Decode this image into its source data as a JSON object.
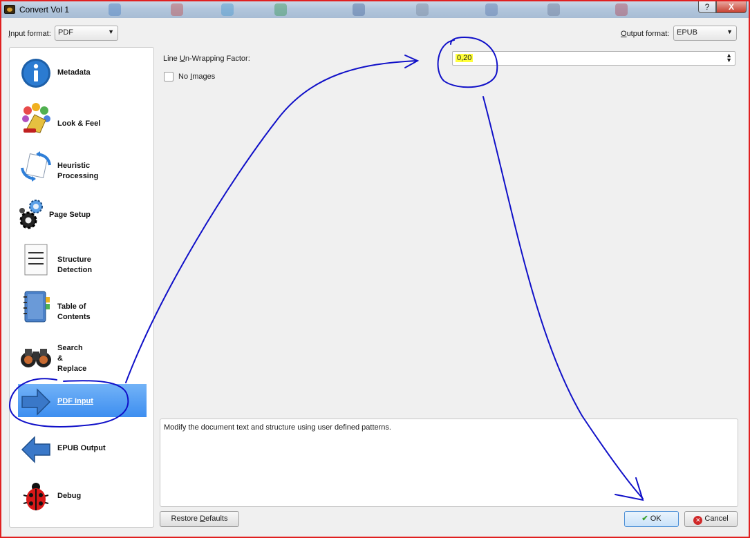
{
  "window": {
    "title": "Convert Vol 1",
    "help_label": "?",
    "close_label": "X"
  },
  "format_bar": {
    "input_label_prefix": "",
    "input_label_u": "I",
    "input_label_rest": "nput format:",
    "input_value": "PDF",
    "output_label_prefix": "",
    "output_label_u": "O",
    "output_label_rest": "utput format:",
    "output_value": "EPUB"
  },
  "sidebar": {
    "items": [
      {
        "label": "Metadata",
        "icon": "info-icon"
      },
      {
        "label": "Look & Feel",
        "icon": "palette-icon"
      },
      {
        "label": "Heuristic\nProcessing",
        "icon": "heuristic-icon"
      },
      {
        "label": "Page Setup",
        "icon": "gears-icon"
      },
      {
        "label": "Structure\nDetection",
        "icon": "document-icon"
      },
      {
        "label": "Table of\nContents",
        "icon": "notebook-icon"
      },
      {
        "label": "Search\n&\nReplace",
        "icon": "binoculars-icon"
      },
      {
        "label": "PDF Input",
        "icon": "arrow-right-icon",
        "active": true
      },
      {
        "label": "EPUB Output",
        "icon": "arrow-left-icon"
      },
      {
        "label": "Debug",
        "icon": "ladybug-icon"
      }
    ]
  },
  "pdf_input": {
    "unwrap_label_prefix": "Line ",
    "unwrap_label_u": "U",
    "unwrap_label_rest": "n-Wrapping Factor:",
    "unwrap_value": "0,20",
    "no_images_prefix": "No ",
    "no_images_u": "I",
    "no_images_rest": "mages",
    "no_images_checked": false
  },
  "help_text": "Modify the document text and structure using user defined patterns.",
  "buttons": {
    "restore_prefix": "Restore ",
    "restore_u": "D",
    "restore_rest": "efaults",
    "ok": "OK",
    "cancel": "Cancel"
  },
  "colors": {
    "highlight": "#ffff3a",
    "annotation": "#1010c8",
    "active_item": "#3d8ef0",
    "window_border": "#e02020"
  }
}
